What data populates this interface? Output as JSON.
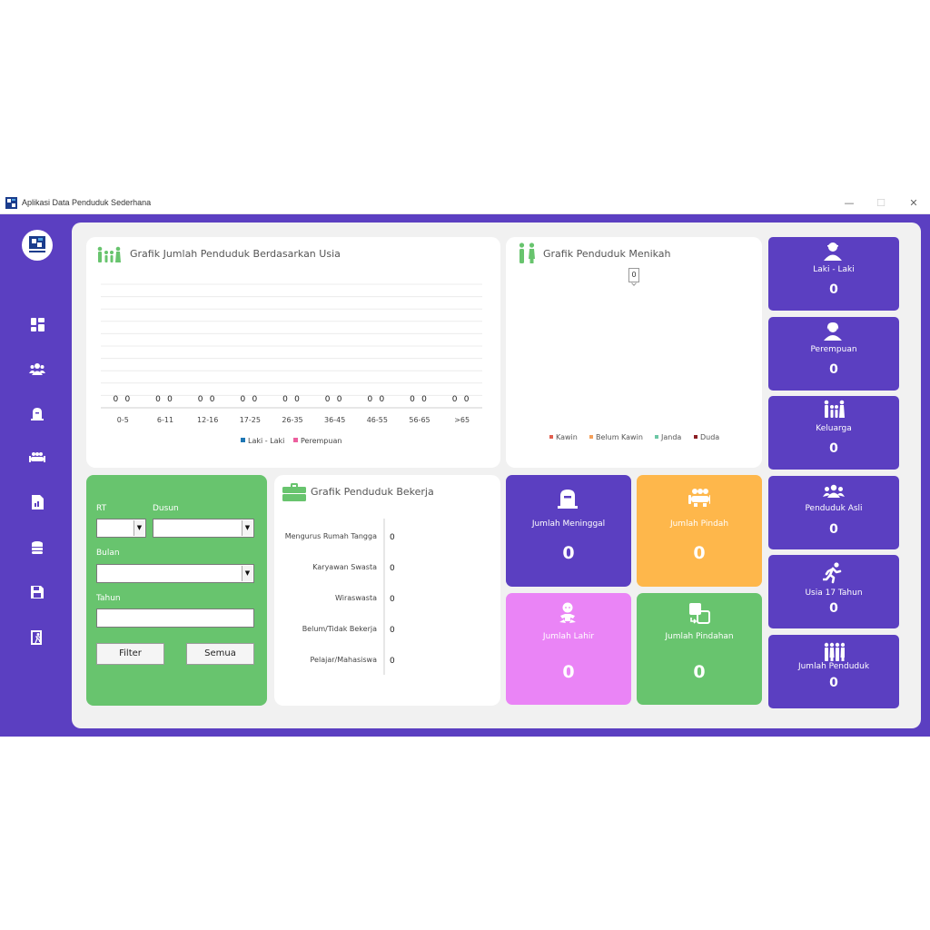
{
  "window": {
    "title": "Aplikasi Data Penduduk Sederhana",
    "minimize": "—",
    "maximize": "☐",
    "close": "✕"
  },
  "sidebar": {
    "items": [
      "dashboard-icon",
      "users-icon",
      "death-icon",
      "migration-icon",
      "report-icon",
      "database-icon",
      "save-icon",
      "exit-icon"
    ]
  },
  "usia_chart": {
    "title": "Grafik Jumlah Penduduk Berdasarkan Usia"
  },
  "menikah_chart": {
    "title": "Grafik Penduduk Menikah",
    "value_label": "0"
  },
  "bekerja_chart": {
    "title": "Grafik Penduduk Bekerja"
  },
  "stats_right": [
    {
      "label": "Laki - Laki",
      "value": "0",
      "icon": "male-user-icon"
    },
    {
      "label": "Perempuan",
      "value": "0",
      "icon": "female-user-icon"
    },
    {
      "label": "Keluarga",
      "value": "0",
      "icon": "family-icon"
    },
    {
      "label": "Penduduk Asli",
      "value": "0",
      "icon": "group-icon"
    },
    {
      "label": "Usia 17 Tahun",
      "value": "0",
      "icon": "running-icon"
    },
    {
      "label": "Jumlah Penduduk",
      "value": "0",
      "icon": "crowd-icon"
    }
  ],
  "stats_mid": [
    {
      "label": "Jumlah Meninggal",
      "value": "0",
      "color": "#5b3fc1",
      "icon": "tombstone-icon"
    },
    {
      "label": "Jumlah Pindah",
      "value": "0",
      "color": "#feb74b",
      "icon": "moving-people-icon"
    },
    {
      "label": "Jumlah Lahir",
      "value": "0",
      "color": "#ea84f6",
      "icon": "baby-icon"
    },
    {
      "label": "Jumlah Pindahan",
      "value": "0",
      "color": "#68c46e",
      "icon": "transfer-icon"
    }
  ],
  "filter": {
    "rt_label": "RT",
    "dusun_label": "Dusun",
    "bulan_label": "Bulan",
    "tahun_label": "Tahun",
    "filter_button": "Filter",
    "semua_button": "Semua",
    "dropdown_arrow": "▼"
  },
  "colors": {
    "purple": "#5b3fc1",
    "green": "#68c46e",
    "orange": "#feb74b",
    "pink": "#ea84f6"
  },
  "chart_data": [
    {
      "type": "bar",
      "categories": [
        "0-5",
        "6-11",
        "12-16",
        "17-25",
        "26-35",
        "36-45",
        "46-55",
        "56-65",
        ">65"
      ],
      "series": [
        {
          "name": "Laki - Laki",
          "values": [
            0,
            0,
            0,
            0,
            0,
            0,
            0,
            0,
            0
          ],
          "color": "#1f77b4"
        },
        {
          "name": "Perempuan",
          "values": [
            0,
            0,
            0,
            0,
            0,
            0,
            0,
            0,
            0
          ],
          "color": "#ec5f9e"
        }
      ],
      "title": "Grafik Jumlah Penduduk Berdasarkan Usia",
      "legend": "bottom",
      "grid": true
    },
    {
      "type": "pie",
      "categories": [
        "Kawin",
        "Belum Kawin",
        "Janda",
        "Duda"
      ],
      "values": [
        0,
        0,
        0,
        0
      ],
      "colors": [
        "#e15f4f",
        "#f5a05a",
        "#6cc7a5",
        "#8b1e24"
      ],
      "title": "Grafik Penduduk Menikah",
      "legend": "bottom"
    },
    {
      "type": "bar",
      "orientation": "horizontal",
      "categories": [
        "Mengurus Rumah Tangga",
        "Karyawan Swasta",
        "Wiraswasta",
        "Belum/Tidak Bekerja",
        "Pelajar/Mahasiswa"
      ],
      "values": [
        0,
        0,
        0,
        0,
        0
      ],
      "title": "Grafik Penduduk Bekerja"
    }
  ]
}
